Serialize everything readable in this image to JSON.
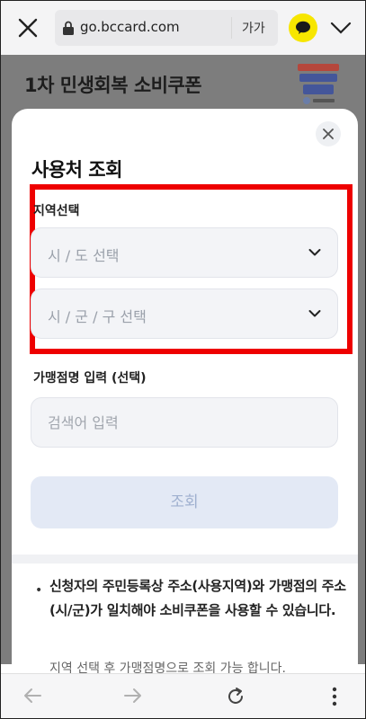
{
  "browser": {
    "url": "go.bccard.com",
    "text_size_label": "가가"
  },
  "background_page": {
    "title": "1차 민생회복 소비쿠폰"
  },
  "modal": {
    "title": "사용처 조회",
    "region_label": "지역선택",
    "province_placeholder": "시 / 도 선택",
    "city_placeholder": "시 / 군 / 구 선택",
    "merchant_label": "가맹점명 입력 (선택)",
    "merchant_placeholder": "검색어 입력",
    "query_button": "조회",
    "note_bullet": "•",
    "note_text": "신청자의 주민등록상 주소(사용지역)와 가맹점의 주소(시/군)가 일치해야 소비쿠폰을 사용할 수 있습니다.",
    "note_text_2": "지역 선택 후 가맹점명으로 조회 가능 합니다."
  },
  "colors": {
    "highlight": "#ee0000",
    "query_button_bg": "#e3e9f5",
    "kakao_yellow": "#f7e600"
  },
  "icons": [
    "close-icon",
    "lock-icon",
    "kakaotalk-icon",
    "chevron-down-icon",
    "back-arrow-icon",
    "forward-arrow-icon",
    "reload-icon",
    "more-vert-icon"
  ]
}
